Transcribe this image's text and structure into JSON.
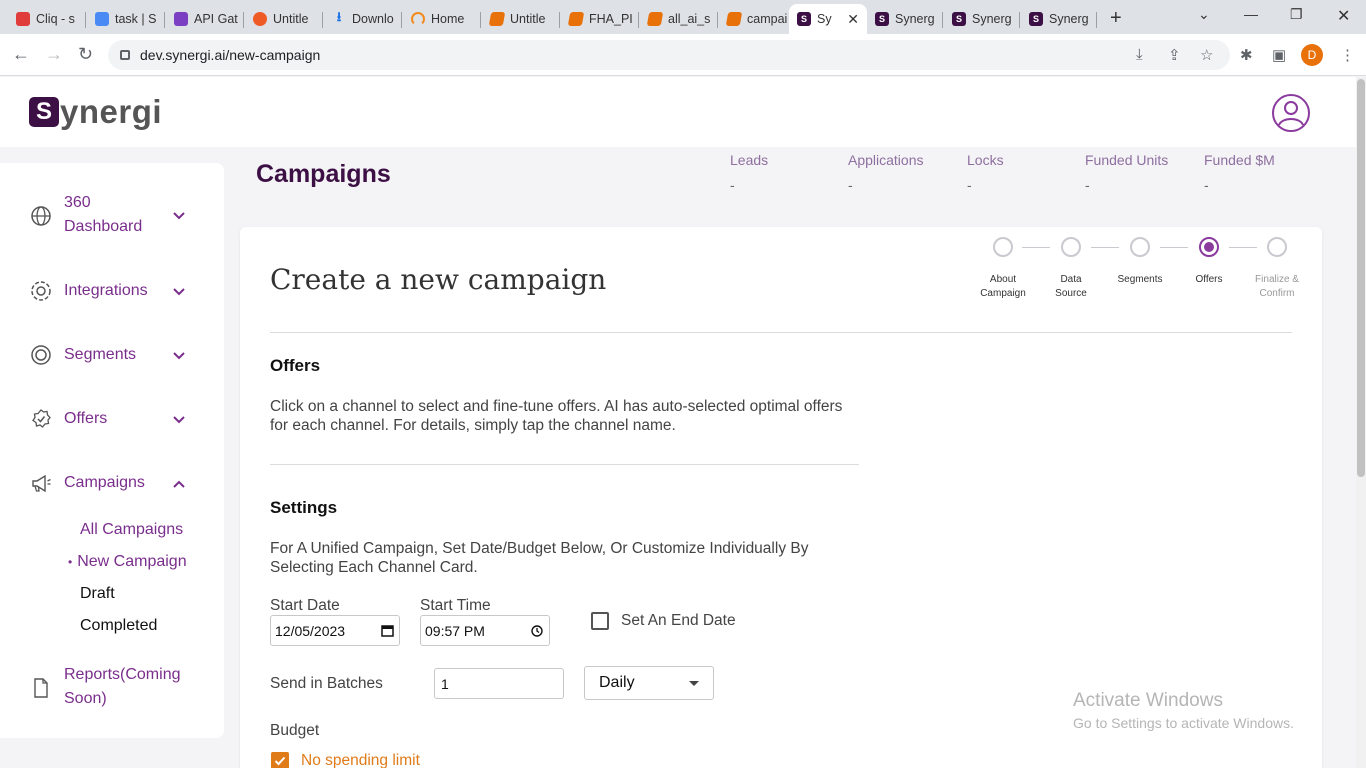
{
  "browser": {
    "tabs": [
      {
        "title": "Cliq - s",
        "icon": "cliq-icon",
        "color": "#e03c3c"
      },
      {
        "title": "task | S",
        "icon": "task-icon",
        "color": "#4a8af4"
      },
      {
        "title": "API Gat",
        "icon": "api-gateway-icon",
        "color": "#7b3fc4"
      },
      {
        "title": "Untitle",
        "icon": "postman-icon",
        "color": "#ef5b25"
      },
      {
        "title": "Downlo",
        "icon": "download-icon",
        "color": "#1a73e8"
      },
      {
        "title": "Home",
        "icon": "home-icon",
        "color": "#f28b1e"
      },
      {
        "title": "Untitle",
        "icon": "doc-icon",
        "color": "#e8710a"
      },
      {
        "title": "FHA_PI",
        "icon": "doc-icon",
        "color": "#e8710a"
      },
      {
        "title": "all_ai_s",
        "icon": "doc-icon",
        "color": "#e8710a"
      },
      {
        "title": "campai",
        "icon": "doc-icon",
        "color": "#e8710a"
      },
      {
        "title": "Sy",
        "icon": "synergi-icon",
        "color": "#3d1045"
      },
      {
        "title": "Synerg",
        "icon": "synergi-icon",
        "color": "#3d1045"
      },
      {
        "title": "Synerg",
        "icon": "synergi-icon",
        "color": "#3d1045"
      },
      {
        "title": "Synerg",
        "icon": "synergi-icon",
        "color": "#3d1045"
      }
    ],
    "url": "dev.synergi.ai/new-campaign",
    "profile_initial": "D"
  },
  "header": {
    "logo_mark": "S",
    "logo_text": "ynergi"
  },
  "sidebar": {
    "items": [
      {
        "label": "360 Dashboard",
        "line1": "360",
        "line2": "Dashboard",
        "icon": "globe-icon"
      },
      {
        "label": "Integrations",
        "icon": "integrations-icon"
      },
      {
        "label": "Segments",
        "icon": "segments-icon"
      },
      {
        "label": "Offers",
        "icon": "offers-icon"
      },
      {
        "label": "Campaigns",
        "icon": "megaphone-icon"
      },
      {
        "label": "Reports(Coming Soon)",
        "line1": "Reports(Coming",
        "line2": "Soon)",
        "icon": "document-icon"
      }
    ],
    "campaign_sub": [
      {
        "label": "All Campaigns"
      },
      {
        "label": "New Campaign",
        "bullet": "•"
      },
      {
        "label": "Draft"
      },
      {
        "label": "Completed"
      }
    ]
  },
  "page": {
    "title": "Campaigns",
    "stats": [
      {
        "label": "Leads",
        "value": "-"
      },
      {
        "label": "Applications",
        "value": "-"
      },
      {
        "label": "Locks",
        "value": "-"
      },
      {
        "label": "Funded Units",
        "value": "-"
      },
      {
        "label": "Funded $M",
        "value": "-"
      }
    ]
  },
  "wizard": {
    "title": "Create a new campaign",
    "steps": [
      {
        "line1": "About",
        "line2": "Campaign"
      },
      {
        "line1": "Data",
        "line2": "Source"
      },
      {
        "line1": "Segments",
        "line2": ""
      },
      {
        "line1": "Offers",
        "line2": ""
      },
      {
        "line1": "Finalize &",
        "line2": "Confirm"
      }
    ],
    "active_step": 3
  },
  "offers": {
    "heading": "Offers",
    "description": "Click on a channel to select and fine-tune offers. AI has auto-selected optimal offers for each channel. For details, simply tap the channel name."
  },
  "settings": {
    "heading": "Settings",
    "description": "For A Unified Campaign, Set Date/Budget Below, Or Customize Individually By Selecting Each Channel Card.",
    "start_date_label": "Start Date",
    "start_date_value": "12/05/2023",
    "start_time_label": "Start Time",
    "start_time_value": "09:57 PM",
    "end_date_label": "Set An End Date",
    "batches_label": "Send in Batches",
    "batches_value": "1",
    "frequency_value": "Daily",
    "budget_label": "Budget",
    "no_limit_label": "No spending limit"
  },
  "watermark": {
    "line1": "Activate Windows",
    "line2": "Go to Settings to activate Windows."
  },
  "colors": {
    "brand": "#3d1045",
    "accent": "#8a3b9d",
    "orange": "#e07b1a"
  }
}
